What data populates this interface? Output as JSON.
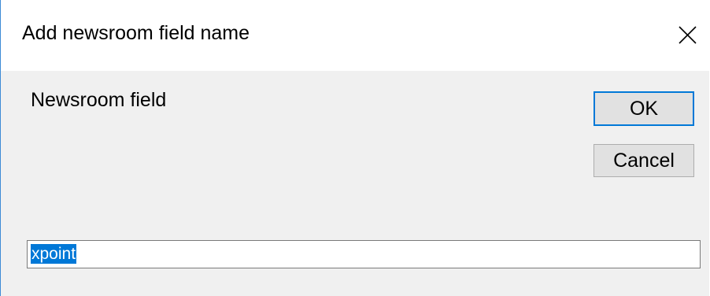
{
  "dialog": {
    "title": "Add newsroom field name",
    "close_icon": "close-icon",
    "field_label": "Newsroom field",
    "input_value": "xpoint",
    "ok_label": "OK",
    "cancel_label": "Cancel"
  },
  "colors": {
    "accent": "#0078d7",
    "background": "#f0f0f0",
    "titlebar": "#ffffff",
    "window_border": "#3c8ad6"
  }
}
